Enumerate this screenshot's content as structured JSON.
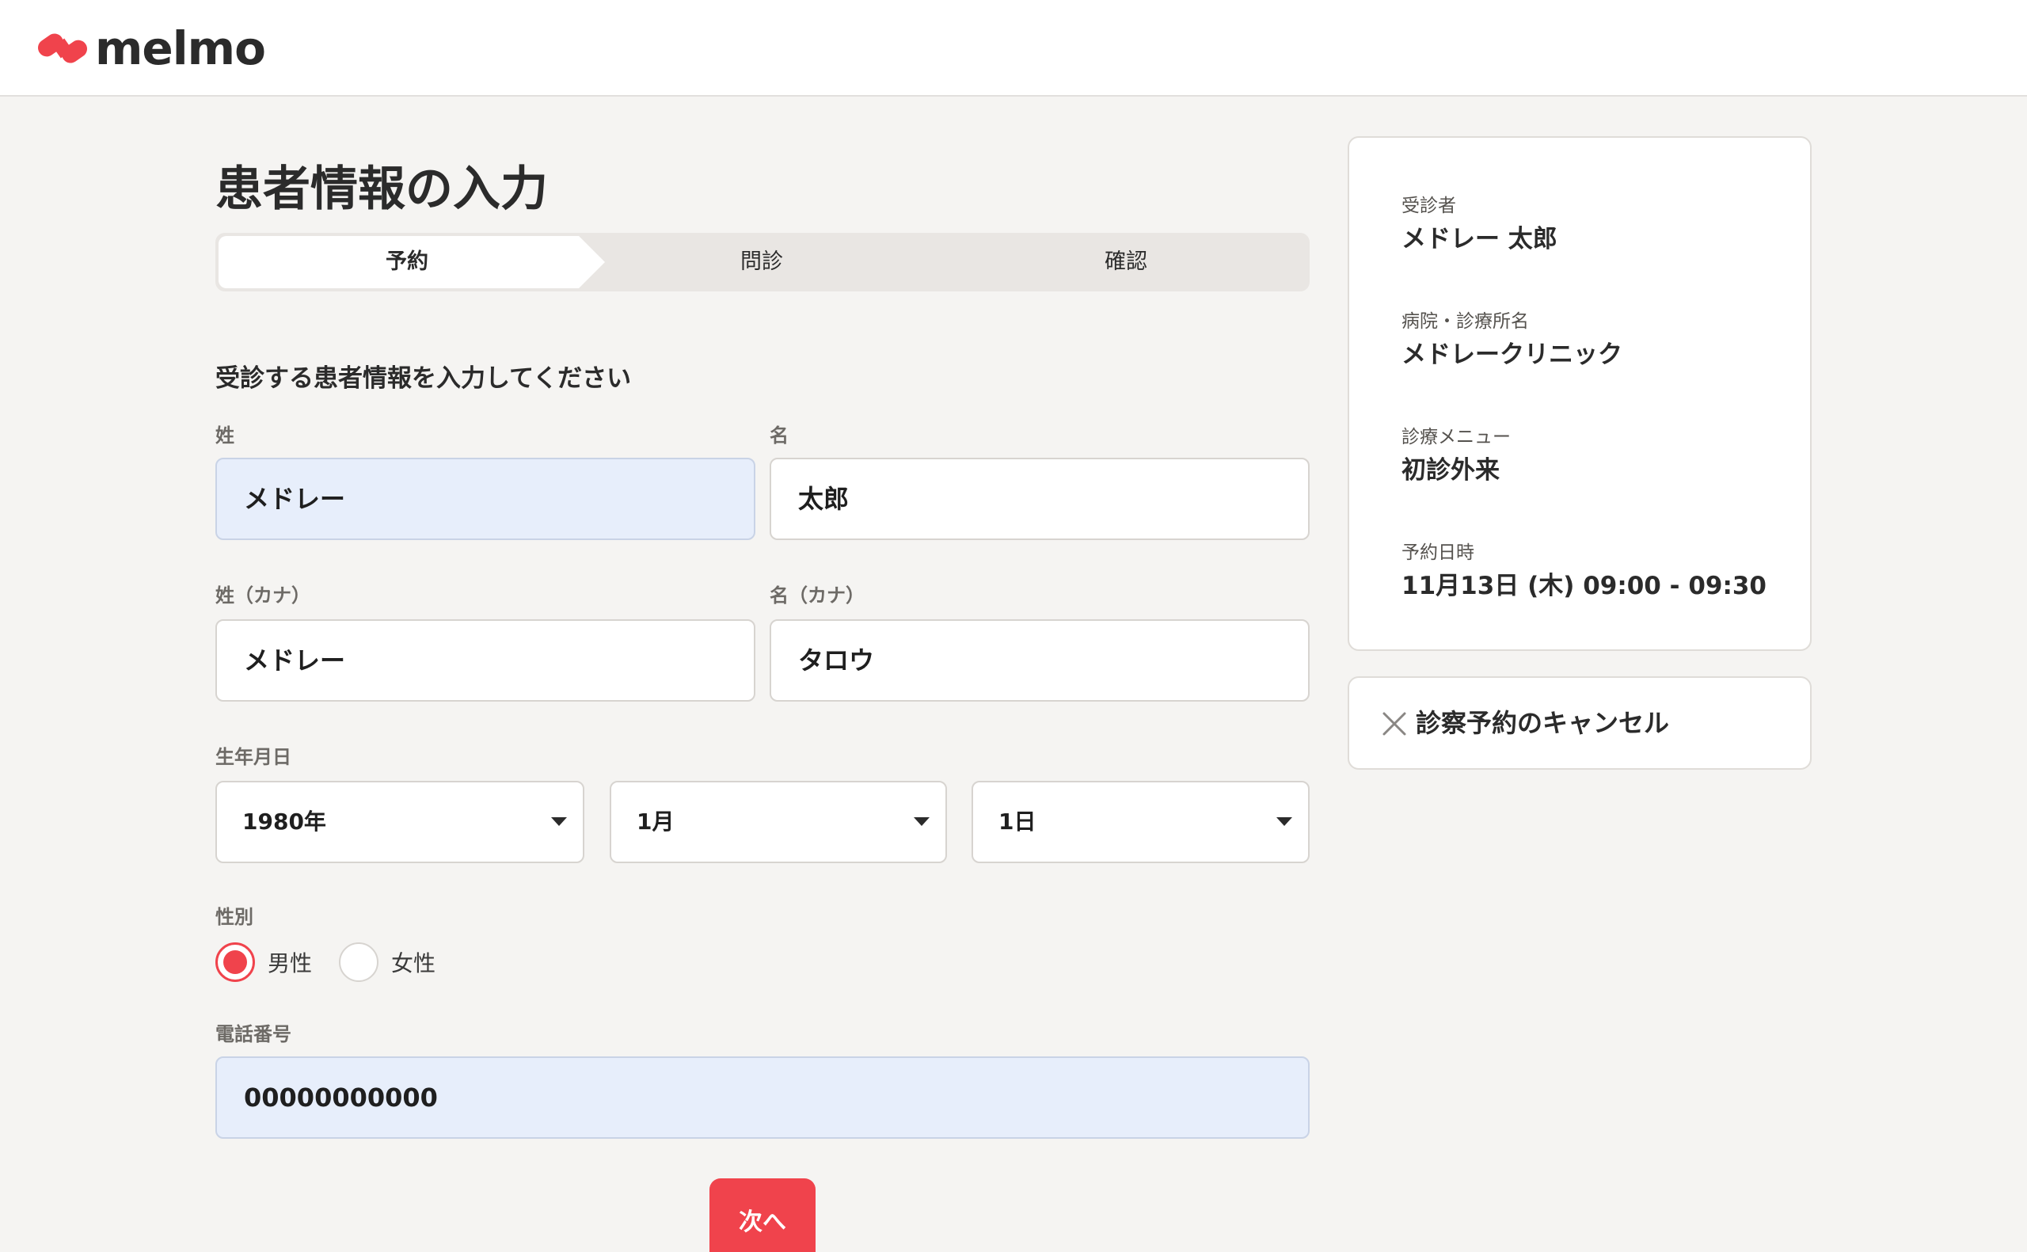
{
  "header": {
    "logo_text": "melmo",
    "brand_color": "#f0434c"
  },
  "page": {
    "title": "患者情報の入力",
    "section_title": "受診する患者情報を入力してください"
  },
  "stepper": {
    "steps": [
      {
        "label": "予約",
        "active": true
      },
      {
        "label": "問診",
        "active": false
      },
      {
        "label": "確認",
        "active": false
      }
    ]
  },
  "form": {
    "last_name": {
      "label": "姓",
      "value": "メドレー"
    },
    "first_name": {
      "label": "名",
      "value": "太郎"
    },
    "last_name_kana": {
      "label": "姓（カナ）",
      "value": "メドレー"
    },
    "first_name_kana": {
      "label": "名（カナ）",
      "value": "タロウ"
    },
    "birthdate": {
      "label": "生年月日",
      "year": "1980年",
      "month": "1月",
      "day": "1日"
    },
    "gender": {
      "label": "性別",
      "options": [
        {
          "label": "男性",
          "checked": true
        },
        {
          "label": "女性",
          "checked": false
        }
      ]
    },
    "phone": {
      "label": "電話番号",
      "value": "00000000000"
    }
  },
  "actions": {
    "next_label": "次へ"
  },
  "summary": {
    "patient_label": "受診者",
    "patient_value": "メドレー 太郎",
    "clinic_label": "病院・診療所名",
    "clinic_value": "メドレークリニック",
    "menu_label": "診療メニュー",
    "menu_value": "初診外来",
    "datetime_label": "予約日時",
    "datetime_value": "11月13日 (木) 09:00 - 09:30"
  },
  "cancel": {
    "label": "診察予約のキャンセル"
  }
}
